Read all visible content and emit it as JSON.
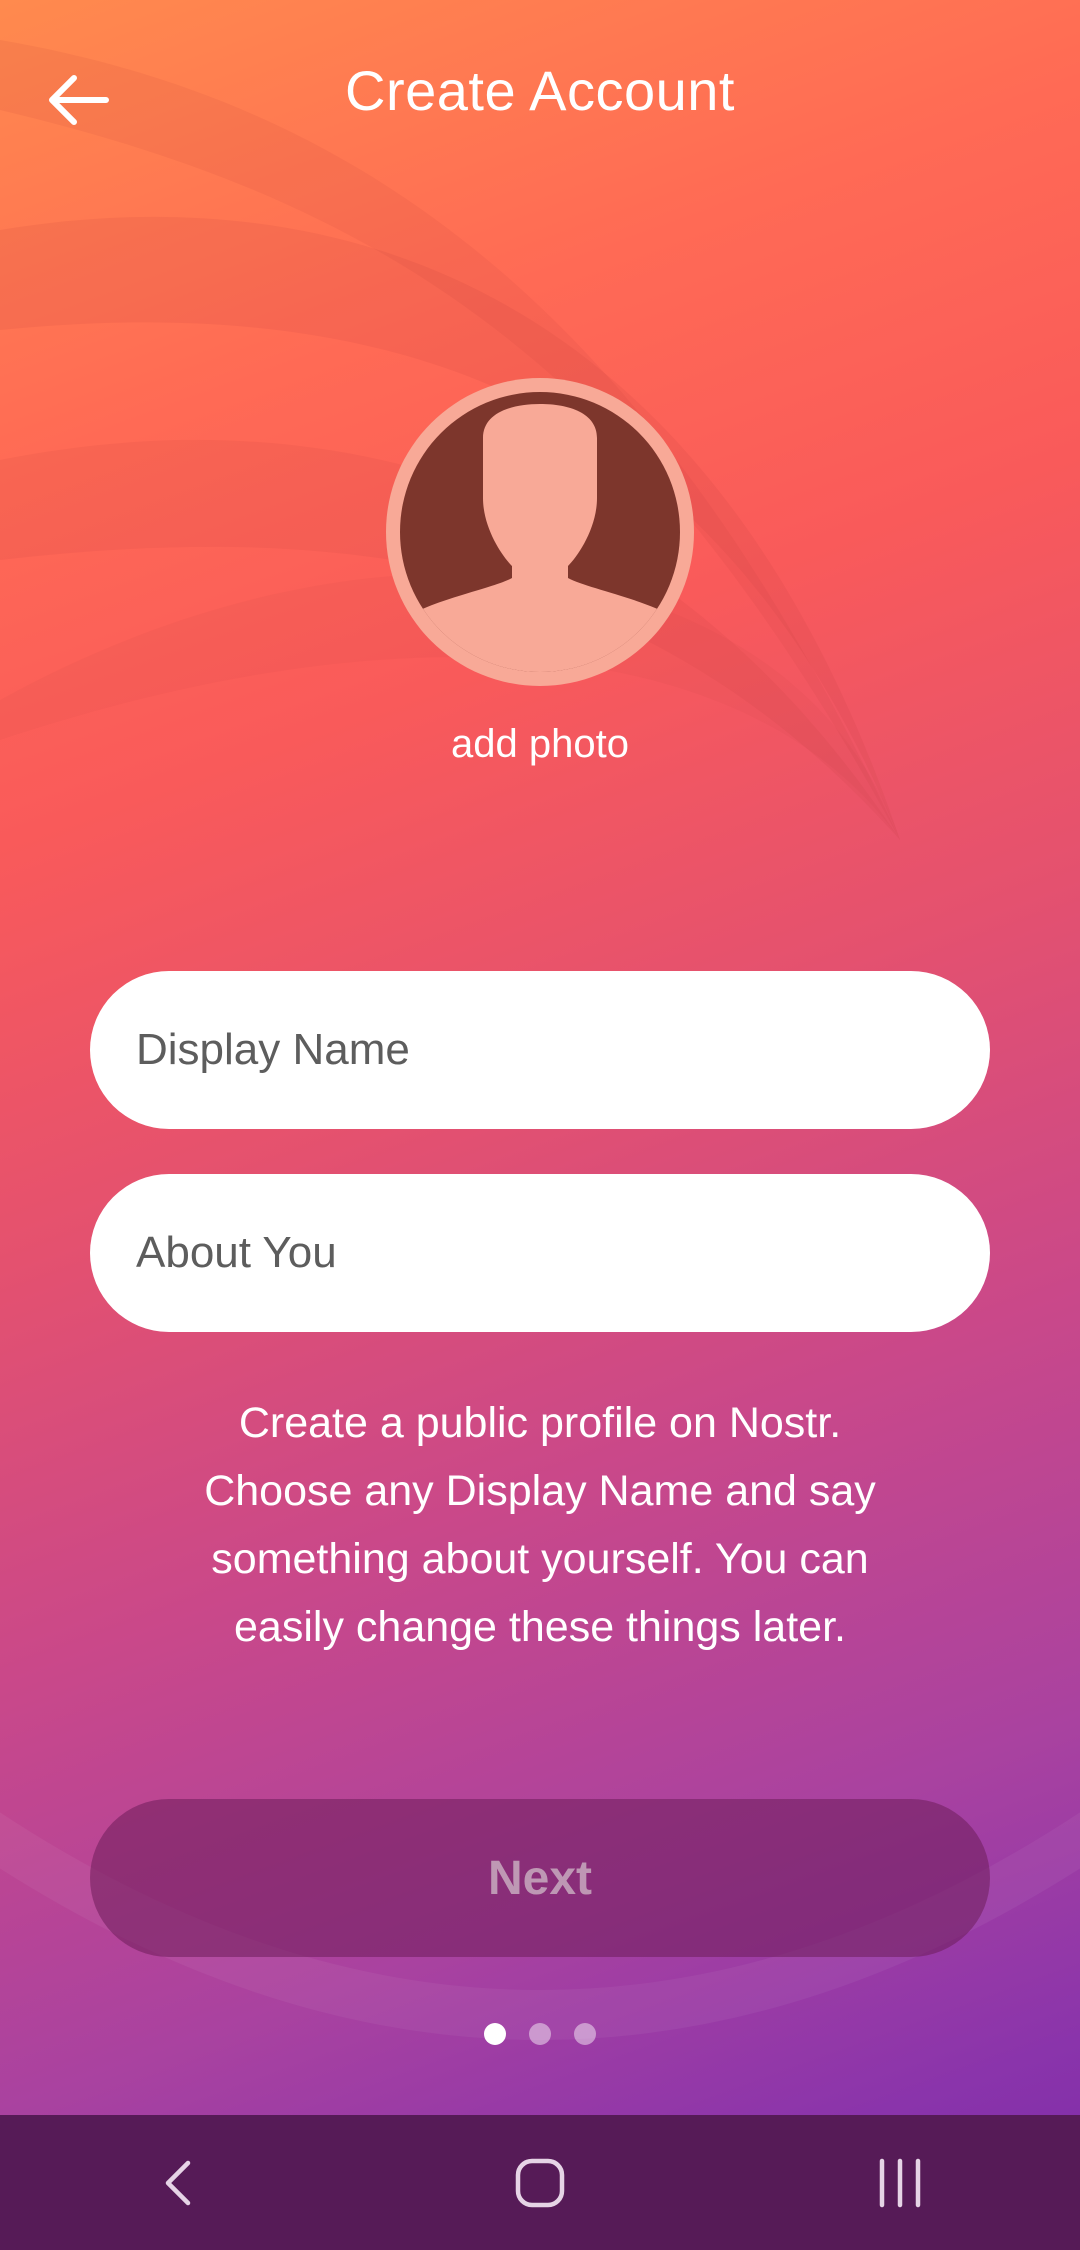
{
  "header": {
    "title": "Create Account",
    "back_icon": "arrow-left-icon"
  },
  "profile": {
    "avatar_icon": "person-silhouette-icon",
    "add_photo_label": "add photo"
  },
  "form": {
    "display_name": {
      "placeholder": "Display Name",
      "value": ""
    },
    "about": {
      "placeholder": "About You",
      "value": ""
    }
  },
  "info_text": "Create a public profile on Nostr. Choose any Display Name and say something about yourself. You can easily change these things later.",
  "next_label": "Next",
  "pagination": {
    "total": 3,
    "active": 1
  },
  "system_nav": {
    "back_icon": "nav-back-icon",
    "home_icon": "nav-home-icon",
    "recents_icon": "nav-recents-icon"
  },
  "colors": {
    "gradient_top": "#ff8a4e",
    "gradient_bottom": "#7b2aa8",
    "avatar_bg": "#f8a997",
    "avatar_fill": "#7d362c",
    "nav_bar": "#561b57"
  }
}
